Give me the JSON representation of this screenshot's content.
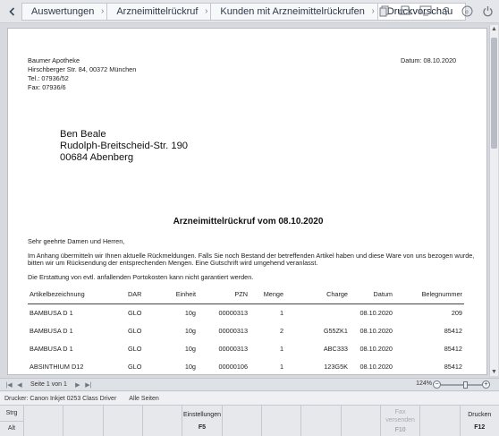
{
  "breadcrumbs": [
    "Auswertungen",
    "Arzneimittelrückruf",
    "Kunden mit Arzneimittelrückrufen",
    "Druckvorschau"
  ],
  "toolbar_icons": [
    "copy-icon",
    "print-icon",
    "monitor-icon",
    "help-icon",
    "info-icon",
    "power-icon"
  ],
  "sender": {
    "name": "Baumer Apotheke",
    "street": "Hirschberger Str. 84, 00372 München",
    "tel": "Tel.: 07936/52",
    "fax": "Fax: 07936/6"
  },
  "date_line": "Datum:  08.10.2020",
  "recipient": {
    "name": "Ben Beale",
    "street": "Rudolph-Breitscheid-Str. 190",
    "city": "00684 Abenberg"
  },
  "document": {
    "title": "Arzneimittelrückruf vom 08.10.2020",
    "salutation": "Sehr geehrte Damen und Herren,",
    "para1_line1": "Im Anhang übermitteln wir Ihnen aktuelle Rückmeldungen. Falls Sie noch Bestand der betreffenden Artikel haben und diese Ware von uns bezogen wurde,",
    "para1_line2": "bitten wir um Rücksendung der entsprechenden Mengen. Eine Gutschrift wird umgehend veranlasst.",
    "para2": "Die Erstattung von evtl. anfallenden Portokosten kann nicht garantiert werden."
  },
  "table": {
    "headers": {
      "artikel": "Artikelbezeichnung",
      "dar": "DAR",
      "einheit": "Einheit",
      "pzn": "PZN",
      "menge": "Menge",
      "charge": "Charge",
      "datum": "Datum",
      "beleg": "Belegnummer"
    },
    "rows": [
      {
        "artikel": "BAMBUSA D 1",
        "dar": "GLO",
        "einheit": "10g",
        "pzn": "00000313",
        "menge": "1",
        "charge": "",
        "datum": "08.10.2020",
        "beleg": "209"
      },
      {
        "artikel": "BAMBUSA D 1",
        "dar": "GLO",
        "einheit": "10g",
        "pzn": "00000313",
        "menge": "2",
        "charge": "G55ZK1",
        "datum": "08.10.2020",
        "beleg": "85412"
      },
      {
        "artikel": "BAMBUSA D 1",
        "dar": "GLO",
        "einheit": "10g",
        "pzn": "00000313",
        "menge": "1",
        "charge": "ABC333",
        "datum": "08.10.2020",
        "beleg": "85412"
      },
      {
        "artikel": "ABSINTHIUM D12",
        "dar": "GLO",
        "einheit": "10g",
        "pzn": "00000106",
        "menge": "1",
        "charge": "123G5K",
        "datum": "08.10.2020",
        "beleg": "85412"
      }
    ]
  },
  "pager": {
    "page_info": "Seite 1 von 1",
    "zoom": "124%",
    "zoom_level": 0.62
  },
  "status": {
    "printer": "Drucker: Canon Inkjet 0253 Class Driver",
    "pages": "Alle Seiten"
  },
  "fkeys": {
    "mod1": "Strg",
    "mod2": "Alt",
    "settings_label": "Einstellungen",
    "settings_key": "F5",
    "fax_label": "Fax versenden",
    "fax_key": "F10",
    "print_label": "Drucken",
    "print_key": "F12"
  }
}
